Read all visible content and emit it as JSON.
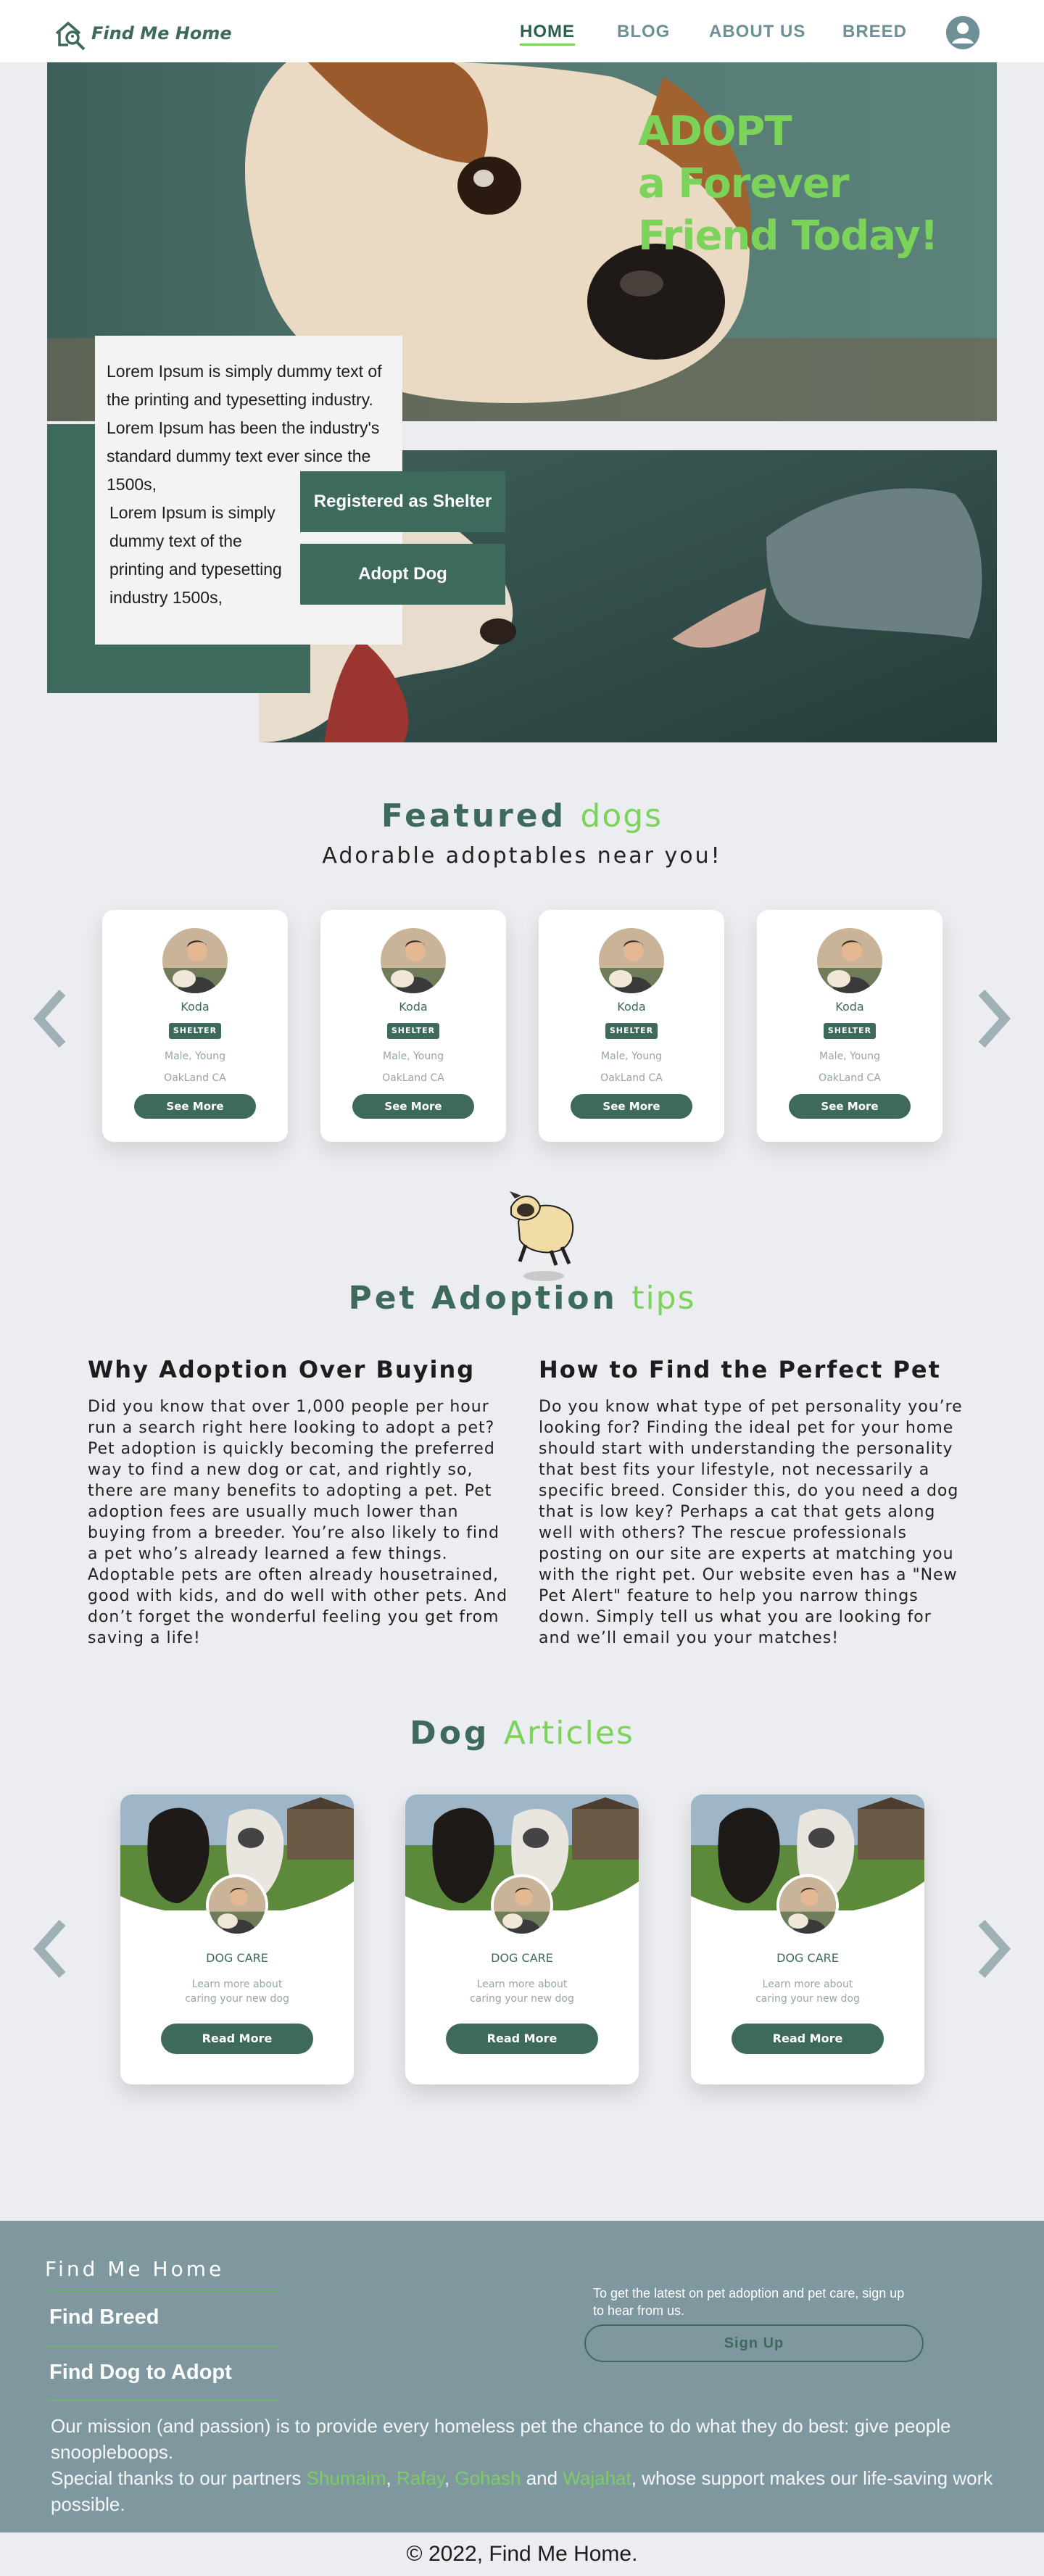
{
  "header": {
    "logo_text": "Find Me Home",
    "nav": [
      "HOME",
      "BLOG",
      "ABOUT US",
      "BREED"
    ]
  },
  "hero": {
    "title_line1": "ADOPT",
    "title_line2": "a Forever",
    "title_line3": "Friend Today!",
    "intro_text": "Lorem Ipsum is simply dummy text of the printing and typesetting industry. Lorem Ipsum has been the industry's standard dummy text ever since the 1500s,",
    "intro_text2": "Lorem Ipsum is simply dummy text of the printing and typesetting industry 1500s,",
    "shelter_button": "Registered as Shelter",
    "adopt_button": "Adopt Dog"
  },
  "featured": {
    "title": "Featured",
    "title_accent": "dogs",
    "subtitle": "Adorable adoptables near you!",
    "cards": [
      {
        "name": "Koda",
        "badge": "SHELTER",
        "meta": "Male, Young",
        "location": "OakLand CA",
        "button": "See More"
      },
      {
        "name": "Koda",
        "badge": "SHELTER",
        "meta": "Male, Young",
        "location": "OakLand CA",
        "button": "See More"
      },
      {
        "name": "Koda",
        "badge": "SHELTER",
        "meta": "Male, Young",
        "location": "OakLand CA",
        "button": "See More"
      },
      {
        "name": "Koda",
        "badge": "SHELTER",
        "meta": "Male, Young",
        "location": "OakLand CA",
        "button": "See More"
      }
    ]
  },
  "tips": {
    "title": "Pet Adoption",
    "title_accent": "tips",
    "left_heading": "Why Adoption Over Buying",
    "left_text": "Did you know that over 1,000 people per hour run a search right here looking to adopt a pet? Pet adoption is quickly becoming the preferred way to find a new dog or cat, and rightly so, there are many benefits to adopting a pet. Pet adoption fees are usually much lower than buying from a breeder. You’re also likely to find a pet who’s already learned a few things. Adoptable pets are often already housetrained, good with kids, and do well with other pets. And don’t forget the wonderful feeling you get from saving a life!",
    "right_heading": "How to Find the Perfect Pet",
    "right_text": "Do you know what type of pet personality you’re looking for? Finding the ideal pet for your home should start with understanding the personality that best fits your lifestyle, not necessarily a specific breed. Consider this, do you need a dog that is low key? Perhaps a cat that gets along well with others? The rescue professionals posting on our site are experts at matching you with the right pet. Our website even has a \"New Pet Alert\" feature to help you narrow things down. Simply tell us what you are looking for and we’ll email you your matches!"
  },
  "articles": {
    "title": "Dog",
    "title_accent": "Articles",
    "cards": [
      {
        "category": "DOG CARE",
        "description": "Learn more about caring your new dog",
        "button": "Read More"
      },
      {
        "category": "DOG CARE",
        "description": "Learn more about caring your new dog",
        "button": "Read More"
      },
      {
        "category": "DOG CARE",
        "description": "Learn more about caring your new dog",
        "button": "Read More"
      }
    ]
  },
  "footer": {
    "brand": "Find Me Home",
    "links": [
      "Find Breed",
      "Find Dog to Adopt"
    ],
    "newsletter_text": "To get the latest on pet adoption and pet care, sign up to hear from us.",
    "signup_button": "Sign Up",
    "mission": "Our mission (and passion) is to provide every homeless pet the chance to do what they do best: give people snoopleboops.",
    "thanks_prefix": "Special thanks to our partners",
    "partners": [
      "Shumaim",
      "Rafay",
      "Gohash",
      "Wajahat"
    ],
    "thanks_suffix": ", whose support makes our life-saving work possible.",
    "copyright": "© 2022, Find Me Home."
  },
  "colors": {
    "brand_green": "#3e6a5e",
    "accent_green": "#7bd35a",
    "footer_bg": "#7f979f",
    "page_bg": "#ecedf0"
  }
}
